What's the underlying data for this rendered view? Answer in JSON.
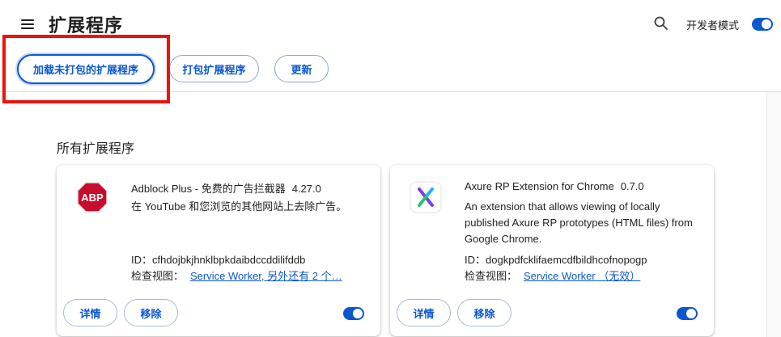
{
  "header": {
    "title": "扩展程序",
    "dev_mode_label": "开发者模式",
    "dev_mode_on": true,
    "menu_icon": "hamburger-menu-icon",
    "search_icon": "search-icon"
  },
  "toolbar": {
    "load_unpacked": "加载未打包的扩展程序",
    "pack_extension": "打包扩展程序",
    "update": "更新"
  },
  "section_title": "所有扩展程序",
  "extensions": [
    {
      "name": "Adblock Plus - 免费的广告拦截器",
      "version": "4.27.0",
      "description": "在 YouTube 和您浏览的其他网站上去除广告。",
      "id_label": "ID：",
      "id": "cfhdojbkjhnklbpkdaibdccddilifddb",
      "inspect_label": "检查视图：",
      "inspect_link": "Service Worker, 另外还有 2 个…",
      "details_label": "详情",
      "remove_label": "移除",
      "enabled": true,
      "icon": "abp-icon",
      "icon_text": "ABP",
      "icon_color": "#c70d2c"
    },
    {
      "name": "Axure RP Extension for Chrome",
      "version": "0.7.0",
      "description": "An extension that allows viewing of locally published Axure RP prototypes (HTML files) from Google Chrome.",
      "id_label": "ID：",
      "id": "dogkpdfcklifaemcdfbildhcofnopogp",
      "inspect_label": "检查视图：",
      "inspect_link": "Service Worker （无效）",
      "details_label": "详情",
      "remove_label": "移除",
      "enabled": true,
      "icon": "axure-icon"
    }
  ],
  "colors": {
    "accent": "#0b57d0",
    "highlight_box": "#e8150f"
  }
}
